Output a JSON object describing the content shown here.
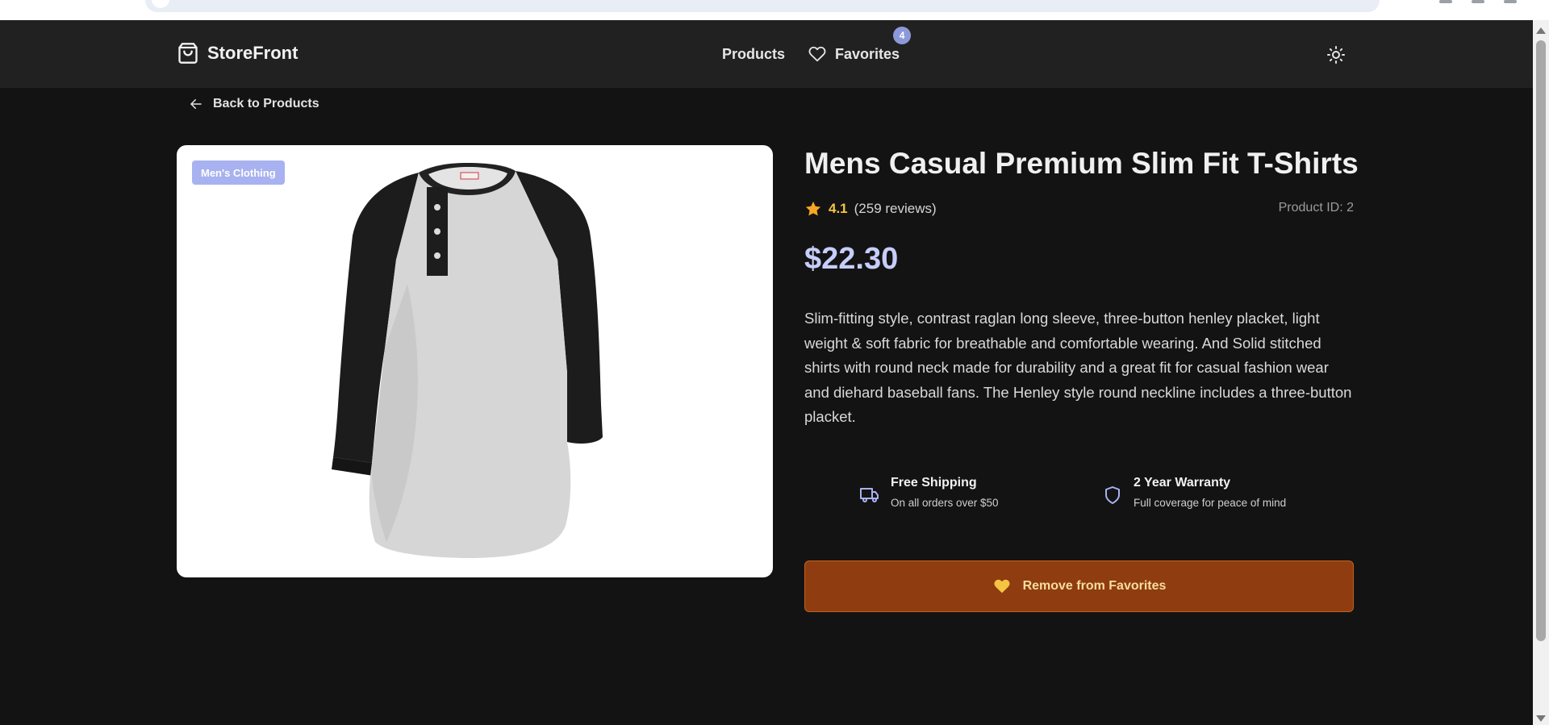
{
  "header": {
    "brand": "StoreFront",
    "nav": {
      "products": "Products",
      "favorites": "Favorites",
      "favorites_count": "4"
    }
  },
  "back_link": "Back to Products",
  "product": {
    "category": "Men's Clothing",
    "title": "Mens Casual Premium Slim Fit T-Shirts",
    "rating": "4.1",
    "reviews": "(259 reviews)",
    "product_id": "Product ID: 2",
    "price": "$22.30",
    "description": "Slim-fitting style, contrast raglan long sleeve, three-button henley placket, light weight & soft fabric for breathable and comfortable wearing. And Solid stitched shirts with round neck made for durability and a great fit for casual fashion wear and diehard baseball fans. The Henley style round neckline includes a three-button placket."
  },
  "features": [
    {
      "title": "Free Shipping",
      "subtitle": "On all orders over $50",
      "icon": "truck-icon"
    },
    {
      "title": "2 Year Warranty",
      "subtitle": "Full coverage for peace of mind",
      "icon": "shield-icon"
    }
  ],
  "actions": {
    "favorite_button": "Remove from Favorites"
  },
  "colors": {
    "background": "#131313",
    "header": "#212121",
    "accent": "#c7cdfa",
    "badge": "#8c99d9",
    "favorite_button": "#8f3c10",
    "rating": "#f5c542"
  }
}
